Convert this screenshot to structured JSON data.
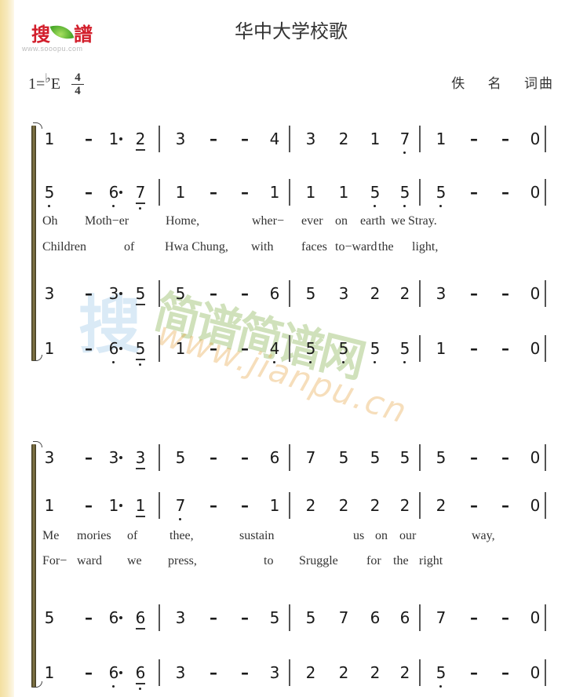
{
  "header": {
    "logo_char_1": "搜",
    "logo_char_2": "譜",
    "logo_url": "www.sooopu.com",
    "title": "华中大学校歌",
    "key": "1=",
    "key_flat": "♭",
    "key_note": "E",
    "time_top": "4",
    "time_bottom": "4",
    "credit": "佚 名 词曲"
  },
  "watermark": {
    "sou": "搜",
    "cn": "简谱简谱网",
    "url": "www.jianpu.cn"
  },
  "systems": [
    {
      "staves": [
        {
          "notes": [
            {
              "t": "1"
            },
            {
              "t": "–",
              "dash": true
            },
            {
              "t": "1",
              "adot": true
            },
            {
              "t": "2",
              "ul": true
            },
            {
              "bar": true
            },
            {
              "t": "3"
            },
            {
              "t": "–",
              "dash": true
            },
            {
              "t": "–",
              "dash": true
            },
            {
              "t": "4"
            },
            {
              "bar": true
            },
            {
              "t": "3"
            },
            {
              "t": "2"
            },
            {
              "t": "1"
            },
            {
              "t": "7",
              "ldot": true
            },
            {
              "bar": true
            },
            {
              "t": "1"
            },
            {
              "t": "–",
              "dash": true
            },
            {
              "t": "–",
              "dash": true
            },
            {
              "t": "0"
            },
            {
              "bar": true
            }
          ]
        },
        {
          "notes": [
            {
              "t": "5",
              "ldot": true
            },
            {
              "t": "–",
              "dash": true
            },
            {
              "t": "6",
              "ldot": true,
              "adot": true
            },
            {
              "t": "7",
              "ul": true,
              "ldot": true
            },
            {
              "bar": true
            },
            {
              "t": "1"
            },
            {
              "t": "–",
              "dash": true
            },
            {
              "t": "–",
              "dash": true
            },
            {
              "t": "1"
            },
            {
              "bar": true
            },
            {
              "t": "1"
            },
            {
              "t": "1"
            },
            {
              "t": "5",
              "ldot": true
            },
            {
              "t": "5",
              "ldot": true
            },
            {
              "bar": true
            },
            {
              "t": "5",
              "ldot": true
            },
            {
              "t": "–",
              "dash": true
            },
            {
              "t": "–",
              "dash": true
            },
            {
              "t": "0"
            },
            {
              "bar": true
            }
          ]
        }
      ],
      "lyrics": [
        [
          "Oh",
          "Moth−er",
          "Home,",
          "wher−",
          "ever",
          "on",
          "earth",
          "we",
          "Stray."
        ],
        [
          "Children",
          "of",
          "Hwa Chung,",
          "with",
          "faces",
          "to−ward",
          "the",
          "light,"
        ]
      ]
    },
    {
      "staves": [
        {
          "notes": [
            {
              "t": "3"
            },
            {
              "t": "–",
              "dash": true
            },
            {
              "t": "3",
              "adot": true
            },
            {
              "t": "5",
              "ul": true
            },
            {
              "bar": true
            },
            {
              "t": "5"
            },
            {
              "t": "–",
              "dash": true
            },
            {
              "t": "–",
              "dash": true
            },
            {
              "t": "6"
            },
            {
              "bar": true
            },
            {
              "t": "5"
            },
            {
              "t": "3"
            },
            {
              "t": "2"
            },
            {
              "t": "2"
            },
            {
              "bar": true
            },
            {
              "t": "3"
            },
            {
              "t": "–",
              "dash": true
            },
            {
              "t": "–",
              "dash": true
            },
            {
              "t": "0"
            },
            {
              "bar": true
            }
          ]
        },
        {
          "notes": [
            {
              "t": "1"
            },
            {
              "t": "–",
              "dash": true
            },
            {
              "t": "6",
              "ldot": true,
              "adot": true
            },
            {
              "t": "5",
              "ul": true,
              "ldot": true
            },
            {
              "bar": true
            },
            {
              "t": "1"
            },
            {
              "t": "–",
              "dash": true
            },
            {
              "t": "–",
              "dash": true
            },
            {
              "t": "4",
              "ldot": true
            },
            {
              "bar": true
            },
            {
              "t": "5",
              "ldot": true
            },
            {
              "t": "5",
              "ldot": true
            },
            {
              "t": "5",
              "ldot": true
            },
            {
              "t": "5",
              "ldot": true
            },
            {
              "bar": true
            },
            {
              "t": "1"
            },
            {
              "t": "–",
              "dash": true
            },
            {
              "t": "–",
              "dash": true
            },
            {
              "t": "0"
            },
            {
              "bar": true
            }
          ]
        }
      ],
      "lyrics": []
    },
    {
      "staves": [
        {
          "notes": [
            {
              "t": "3"
            },
            {
              "t": "–",
              "dash": true
            },
            {
              "t": "3",
              "adot": true
            },
            {
              "t": "3",
              "ul": true
            },
            {
              "bar": true
            },
            {
              "t": "5"
            },
            {
              "t": "–",
              "dash": true
            },
            {
              "t": "–",
              "dash": true
            },
            {
              "t": "6"
            },
            {
              "bar": true
            },
            {
              "t": "7"
            },
            {
              "t": "5"
            },
            {
              "t": "5"
            },
            {
              "t": "5"
            },
            {
              "bar": true
            },
            {
              "t": "5"
            },
            {
              "t": "–",
              "dash": true
            },
            {
              "t": "–",
              "dash": true
            },
            {
              "t": "0"
            },
            {
              "bar": true
            }
          ]
        },
        {
          "notes": [
            {
              "t": "1"
            },
            {
              "t": "–",
              "dash": true
            },
            {
              "t": "1",
              "adot": true
            },
            {
              "t": "1",
              "ul": true
            },
            {
              "bar": true
            },
            {
              "t": "7",
              "ldot": true
            },
            {
              "t": "–",
              "dash": true
            },
            {
              "t": "–",
              "dash": true
            },
            {
              "t": "1"
            },
            {
              "bar": true
            },
            {
              "t": "2"
            },
            {
              "t": "2"
            },
            {
              "t": "2"
            },
            {
              "t": "2"
            },
            {
              "bar": true
            },
            {
              "t": "2"
            },
            {
              "t": "–",
              "dash": true
            },
            {
              "t": "–",
              "dash": true
            },
            {
              "t": "0"
            },
            {
              "bar": true
            }
          ]
        }
      ],
      "lyrics": [
        [
          "Me",
          "mories",
          "of",
          "thee,",
          "sustain",
          "us",
          "on",
          "our",
          "way,"
        ],
        [
          "For−",
          "ward",
          "we",
          "press,",
          "to",
          "Sruggle",
          "for",
          "the",
          "right"
        ]
      ]
    },
    {
      "staves": [
        {
          "notes": [
            {
              "t": "5"
            },
            {
              "t": "–",
              "dash": true
            },
            {
              "t": "6",
              "adot": true
            },
            {
              "t": "6",
              "ul": true
            },
            {
              "bar": true
            },
            {
              "t": "3"
            },
            {
              "t": "–",
              "dash": true
            },
            {
              "t": "–",
              "dash": true
            },
            {
              "t": "5"
            },
            {
              "bar": true
            },
            {
              "t": "5"
            },
            {
              "t": "7"
            },
            {
              "t": "6"
            },
            {
              "t": "6"
            },
            {
              "bar": true
            },
            {
              "t": "7"
            },
            {
              "t": "–",
              "dash": true
            },
            {
              "t": "–",
              "dash": true
            },
            {
              "t": "0"
            },
            {
              "bar": true
            }
          ]
        },
        {
          "notes": [
            {
              "t": "1"
            },
            {
              "t": "–",
              "dash": true
            },
            {
              "t": "6",
              "ldot": true,
              "adot": true
            },
            {
              "t": "6",
              "ul": true,
              "ldot": true
            },
            {
              "bar": true
            },
            {
              "t": "3"
            },
            {
              "t": "–",
              "dash": true
            },
            {
              "t": "–",
              "dash": true
            },
            {
              "t": "3"
            },
            {
              "bar": true
            },
            {
              "t": "2"
            },
            {
              "t": "2"
            },
            {
              "t": "2"
            },
            {
              "t": "2"
            },
            {
              "bar": true
            },
            {
              "t": "5",
              "ldot": true
            },
            {
              "t": "–",
              "dash": true
            },
            {
              "t": "–",
              "dash": true
            },
            {
              "t": "0"
            },
            {
              "bar": true
            }
          ]
        }
      ],
      "lyrics": []
    }
  ]
}
